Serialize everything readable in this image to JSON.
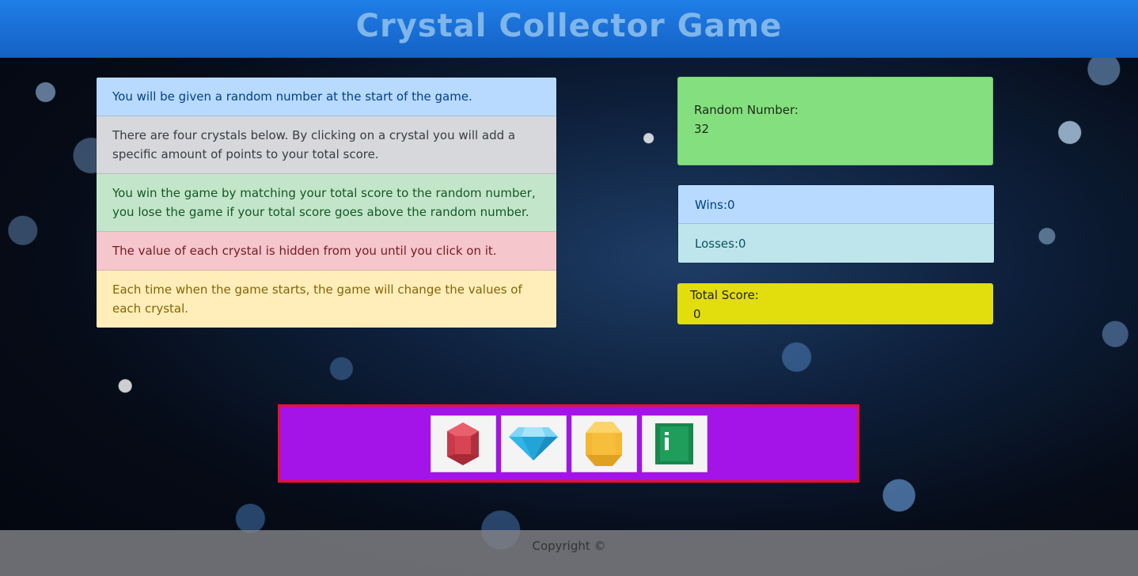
{
  "header": {
    "title": "Crystal Collector Game"
  },
  "instructions": [
    {
      "text": "You will be given a random number at the start of the game."
    },
    {
      "text": "There are four crystals below. By clicking on a crystal you will add a specific amount of points to your total score."
    },
    {
      "text": "You win the game by matching your total score to the random number, you lose the game if your total score goes above the random number."
    },
    {
      "text": "The value of each crystal is hidden from you until you click on it."
    },
    {
      "text": "Each time when the game starts, the game will change the values of each crystal."
    }
  ],
  "random_number": {
    "label": "Random Number:",
    "value": "32"
  },
  "record": {
    "wins": "Wins:0",
    "losses": "Losses:0"
  },
  "total_score": {
    "label": "Total Score:",
    "value": "0"
  },
  "crystals": [
    {
      "icon": "red-gem-icon",
      "color": "#d94452"
    },
    {
      "icon": "blue-diamond-icon",
      "color": "#2fb6e8"
    },
    {
      "icon": "yellow-gem-icon",
      "color": "#f5b731"
    },
    {
      "icon": "green-gem-icon",
      "color": "#1e9e5a"
    }
  ],
  "footer": {
    "text": "Copyright ©"
  },
  "colors": {
    "header": "#1a6fd6",
    "crystal_bar": "#a414e8",
    "crystal_bar_border": "#e8102e",
    "random_box": "#84e07f",
    "score_box": "#e2dd0d"
  }
}
